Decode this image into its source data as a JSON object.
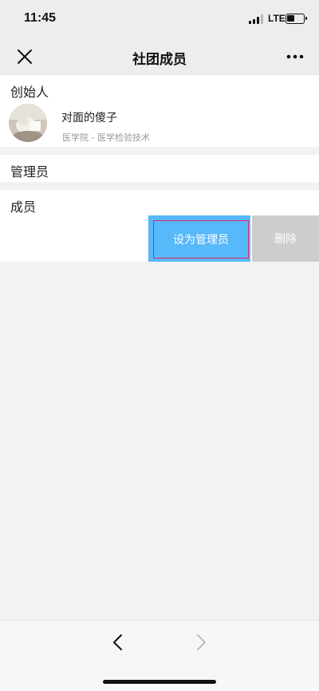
{
  "status_bar": {
    "time": "11:45",
    "network": "LTE",
    "icons": [
      "signal-icon",
      "battery-icon"
    ]
  },
  "nav": {
    "title": "社团成员",
    "icons": [
      "close-icon",
      "more-icon"
    ]
  },
  "founder_section": {
    "header": "创始人",
    "member": {
      "name": "对面的傻子",
      "subtitle": "医学院 - 医学检验技术"
    }
  },
  "admin_section": {
    "header": "管理员"
  },
  "member_section": {
    "header": "成员",
    "actions": {
      "set_admin_label": "设为管理员",
      "delete_label": "删除"
    }
  },
  "toolbar": {
    "icons": [
      "back-arrow-icon",
      "forward-arrow-icon"
    ]
  },
  "colors": {
    "set_admin_bg": "#57b8fa",
    "delete_bg": "#cdcdcd",
    "highlight_border": "#e0286a",
    "page_bg": "#f2f2f1"
  }
}
